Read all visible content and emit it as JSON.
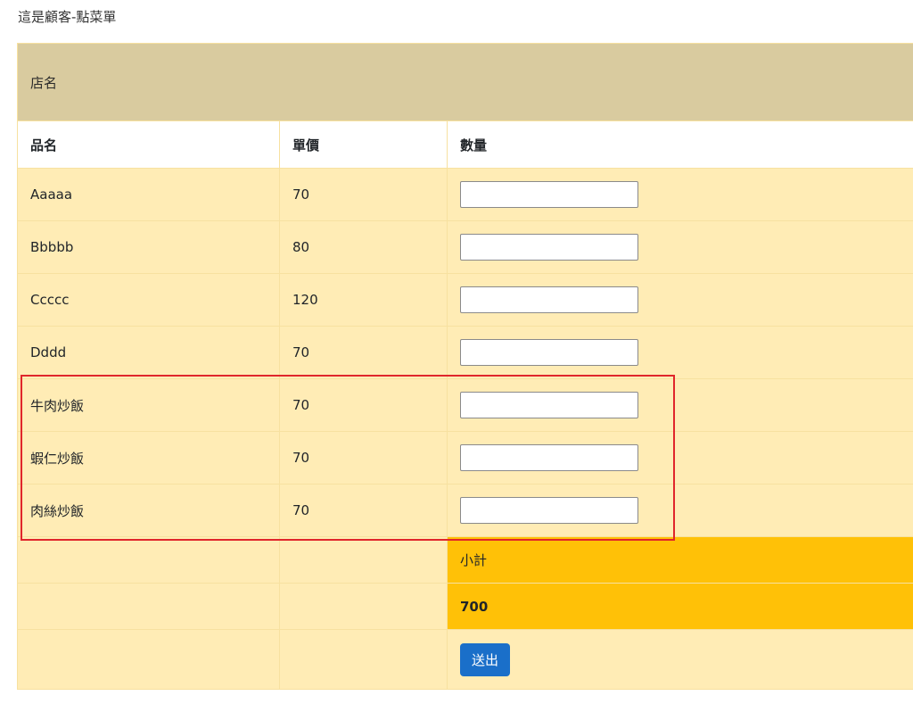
{
  "page": {
    "caption": "這是顧客-點菜單"
  },
  "menu": {
    "store_name": "店名",
    "columns": [
      "品名",
      "單價",
      "數量"
    ],
    "items": [
      {
        "name": "Aaaaa",
        "price": "70",
        "quantity": ""
      },
      {
        "name": "Bbbbb",
        "price": "80",
        "quantity": ""
      },
      {
        "name": "Ccccc",
        "price": "120",
        "quantity": ""
      },
      {
        "name": "Dddd",
        "price": "70",
        "quantity": ""
      },
      {
        "name": "牛肉炒飯",
        "price": "70",
        "quantity": ""
      },
      {
        "name": "蝦仁炒飯",
        "price": "70",
        "quantity": ""
      },
      {
        "name": "肉絲炒飯",
        "price": "70",
        "quantity": ""
      }
    ],
    "subtotal_label": "小計",
    "subtotal_value": "700",
    "submit_label": "送出"
  },
  "colors": {
    "store_header_bg": "#d9cb9f",
    "row_bg": "#ffecb5",
    "subtotal_bg": "#ffc107",
    "submit_bg": "#1a6fc9",
    "highlight_border": "#e0262b"
  }
}
